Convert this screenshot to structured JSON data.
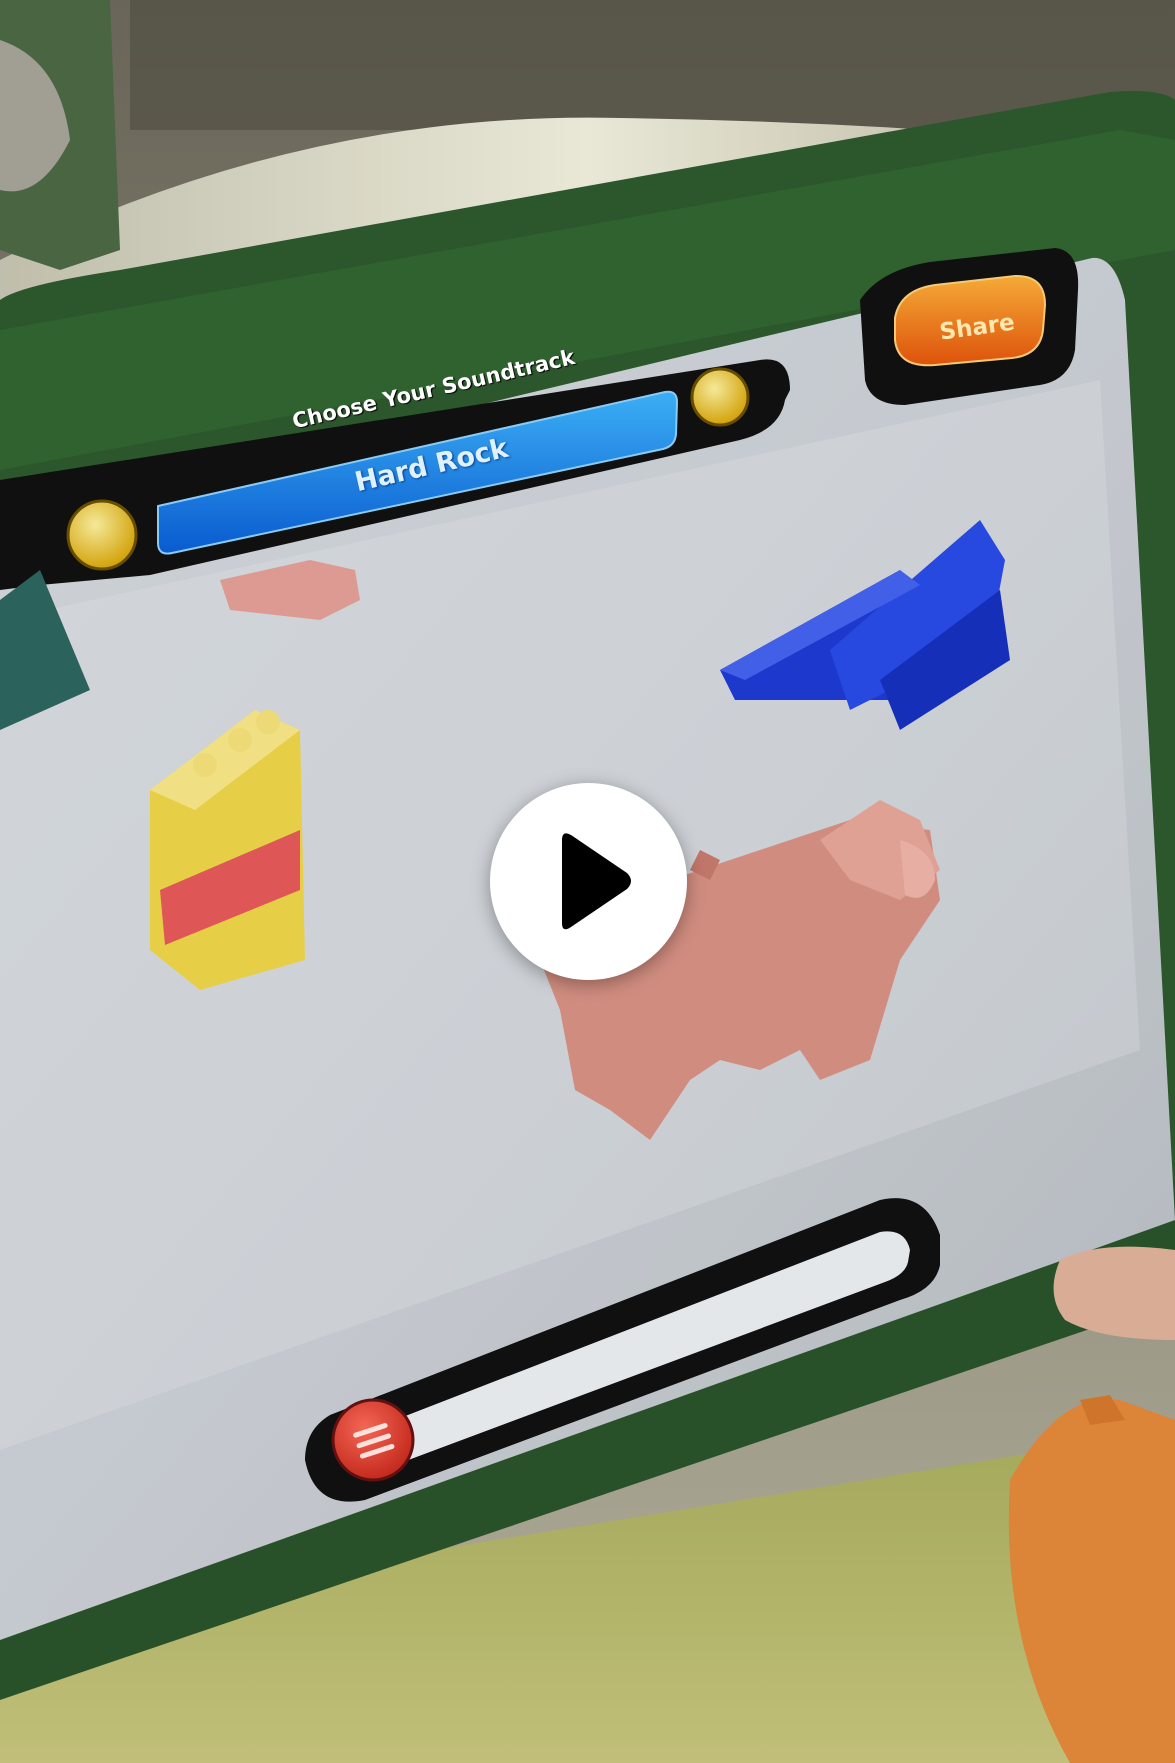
{
  "player": {
    "controls": {
      "play_icon": "play-icon"
    }
  },
  "app_screen": {
    "soundtrack_header": "Choose Your Soundtrack",
    "soundtrack_selected": "Hard Rock",
    "share_label": "Share",
    "icons": {
      "prev": "chevron-left-icon",
      "next": "chevron-right-icon",
      "menu": "menu-icon"
    }
  }
}
